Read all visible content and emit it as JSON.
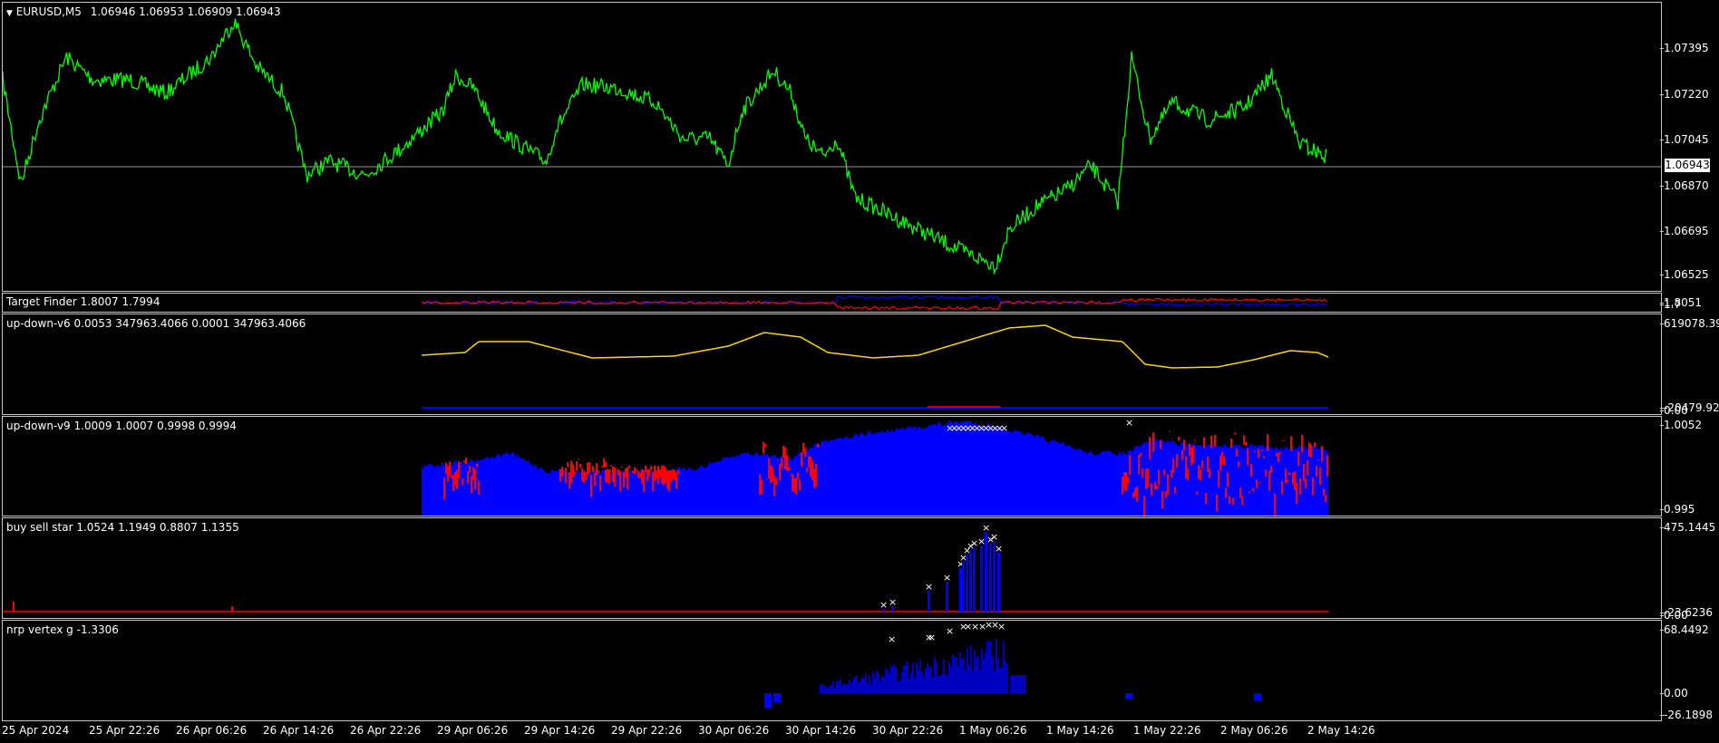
{
  "main_chart": {
    "symbol_label": "EURUSD,M5",
    "ohlc": "1.06946 1.06953 1.06909 1.06943",
    "price_ticks": [
      "1.07395",
      "1.07220",
      "1.07045",
      "1.06870",
      "1.06695",
      "1.06525"
    ],
    "current_price": "1.06943",
    "line_color": "#00ff00"
  },
  "panes": [
    {
      "label": "Target Finder 1.8007 1.7994",
      "ticks": [
        "1.8051",
        "1.7"
      ]
    },
    {
      "label": "up-down-v6 0.0053 347963.4066 0.0001 347963.4066",
      "ticks": [
        "619078.39",
        "0.00",
        "-20479.92"
      ]
    },
    {
      "label": "up-down-v9 1.0009 1.0007 0.9998 0.9994",
      "ticks": [
        "1.0052",
        "0.995"
      ]
    },
    {
      "label": "buy sell star 1.0524 1.1949 0.8807 1.1355",
      "ticks": [
        "475.1445",
        "0.00",
        "-23.6236"
      ]
    },
    {
      "label": "nrp vertex g -1.3306",
      "ticks": [
        "68.4492",
        "0.00",
        "-26.1898"
      ]
    }
  ],
  "time_axis": [
    "25 Apr 2024",
    "25 Apr 22:26",
    "26 Apr 06:26",
    "26 Apr 14:26",
    "26 Apr 22:26",
    "29 Apr 06:26",
    "29 Apr 14:26",
    "29 Apr 22:26",
    "30 Apr 06:26",
    "30 Apr 14:26",
    "30 Apr 22:26",
    "1 May 06:26",
    "1 May 14:26",
    "1 May 22:26",
    "2 May 06:26",
    "2 May 14:26"
  ],
  "colors": {
    "price": "#00ff00",
    "blue": "#0000ff",
    "red": "#ff0000",
    "yellow": "#ffd700",
    "marker": "#ffffff"
  }
}
